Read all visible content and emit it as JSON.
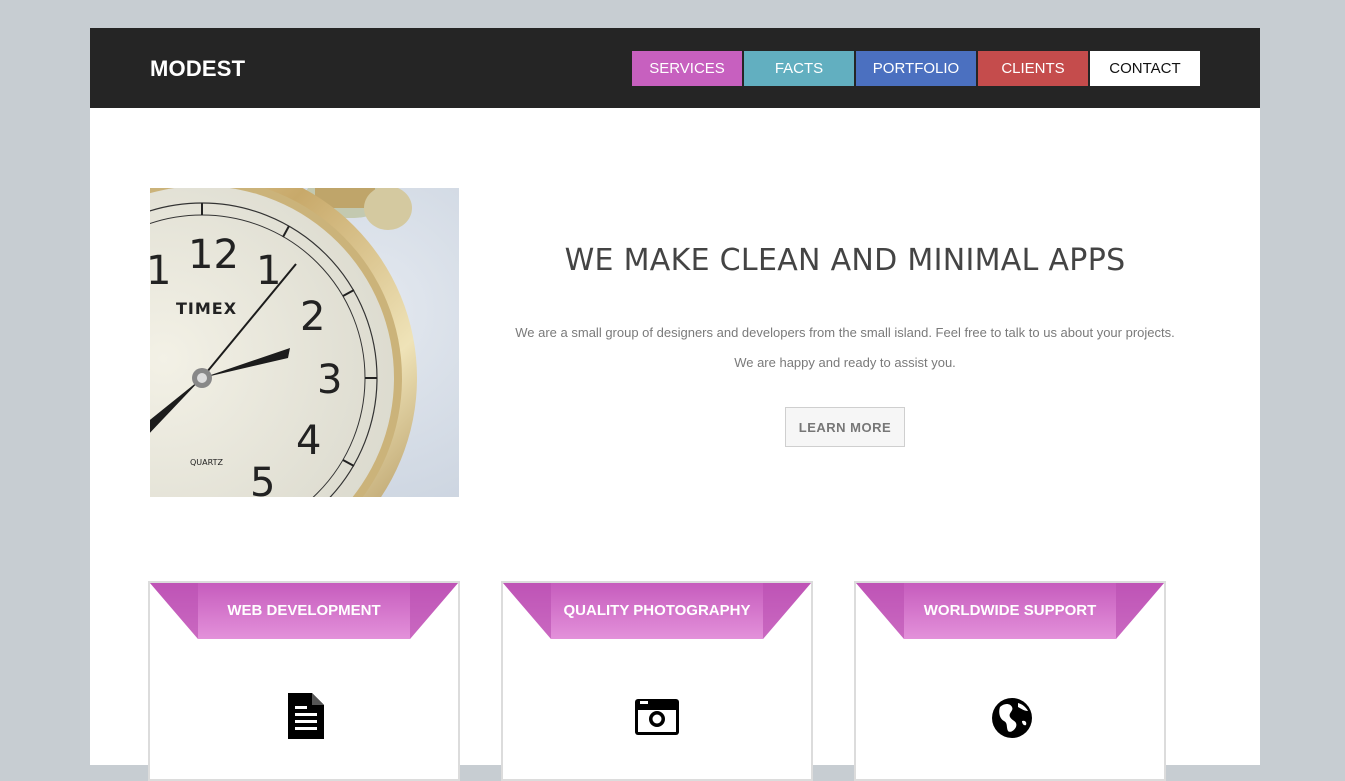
{
  "header": {
    "logo": "MODEST",
    "nav": [
      {
        "label": "SERVICES",
        "color": "#c760bf"
      },
      {
        "label": "FACTS",
        "color": "#62afc0"
      },
      {
        "label": "PORTFOLIO",
        "color": "#4b70c0"
      },
      {
        "label": "CLIENTS",
        "color": "#c54c4c"
      },
      {
        "label": "CONTACT",
        "color": "#ffffff"
      }
    ]
  },
  "hero": {
    "image_icon": "alarm-clock-photo",
    "clock_brand": "TIMEX",
    "clock_sub": "QUARTZ",
    "title": "WE MAKE CLEAN AND MINIMAL APPS",
    "text_line1": "We are a small group of designers and developers from the small island. Feel free to talk to us about your projects.",
    "text_line2": "We are happy and ready to assist you.",
    "button_label": "LEARN MORE"
  },
  "features": [
    {
      "title": "WEB DEVELOPMENT",
      "icon": "document-icon"
    },
    {
      "title": "QUALITY PHOTOGRAPHY",
      "icon": "camera-icon"
    },
    {
      "title": "WORLDWIDE SUPPORT",
      "icon": "globe-icon"
    }
  ],
  "colors": {
    "accent_pink": "#c760bf",
    "ribbon_light": "#e08ad6",
    "dark_bar": "#252525",
    "background": "#c7cdd2"
  }
}
